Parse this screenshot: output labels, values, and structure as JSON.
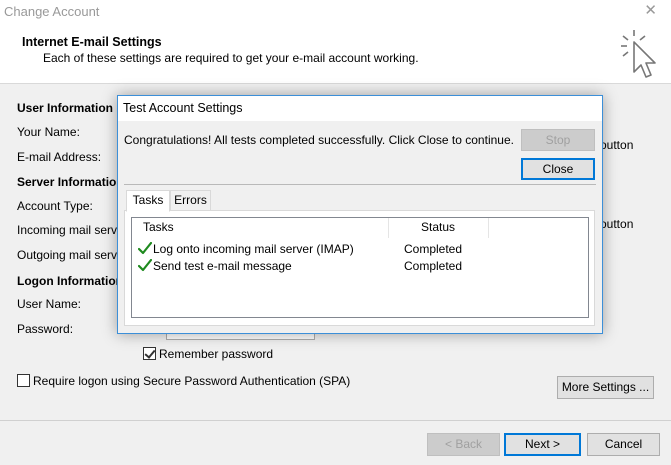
{
  "window": {
    "title": "Change Account"
  },
  "header": {
    "title": "Internet E-mail Settings",
    "subtitle": "Each of these settings are required to get your e-mail account working."
  },
  "form": {
    "user_info_label": "User Information",
    "your_name_label": "Your Name:",
    "email_label": "E-mail Address:",
    "server_info_label": "Server Informatio",
    "account_type_label": "Account Type:",
    "incoming_label": "Incoming mail server:",
    "outgoing_label": "Outgoing mail server",
    "logon_info_label": "Logon Information",
    "username_label": "User Name:",
    "password_label": "Password:",
    "remember_password_label": "Remember password",
    "remember_password_checked": true,
    "spa_label": "Require logon using Secure Password Authentication (SPA)",
    "spa_checked": false,
    "right_button_fragment_1": "outton",
    "right_button_fragment_2": "outton"
  },
  "buttons": {
    "more_settings": "More Settings ...",
    "back": "< Back",
    "next": "Next >",
    "cancel": "Cancel"
  },
  "modal": {
    "title": "Test Account Settings",
    "message": "Congratulations! All tests completed successfully. Click Close to continue.",
    "stop_label": "Stop",
    "close_label": "Close",
    "tabs": [
      "Tasks",
      "Errors"
    ],
    "active_tab": "Tasks",
    "columns": [
      "Tasks",
      "Status"
    ],
    "rows": [
      {
        "task": "Log onto incoming mail server (IMAP)",
        "status": "Completed",
        "icon": "check-icon"
      },
      {
        "task": "Send test e-mail message",
        "status": "Completed",
        "icon": "check-icon"
      }
    ]
  },
  "colors": {
    "accent": "#0078d7",
    "check_green": "#1e8a1e"
  }
}
